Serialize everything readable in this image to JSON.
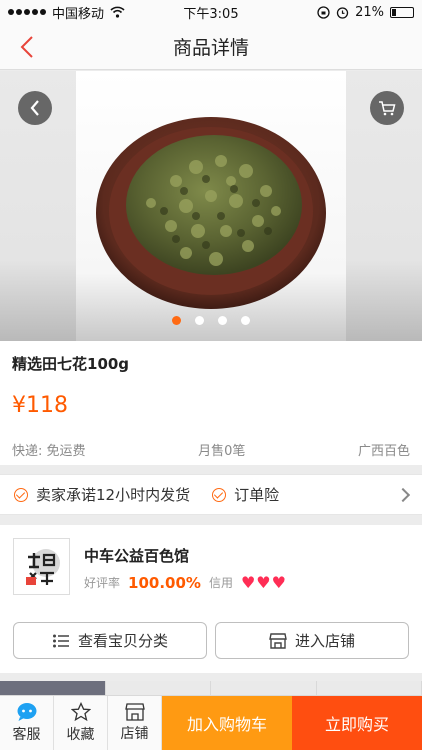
{
  "status": {
    "carrier": "中国移动",
    "time": "下午3:05",
    "battery": "21%"
  },
  "nav": {
    "title": "商品详情"
  },
  "gallery": {
    "pages": 4,
    "active_index": 0
  },
  "product": {
    "title": "精选田七花100g",
    "price": "¥118",
    "shipping": "快递: 免运费",
    "monthly_sales": "月售0笔",
    "location": "广西百色"
  },
  "promise": {
    "item1": "卖家承诺12小时内发货",
    "item2": "订单险"
  },
  "shop": {
    "name": "中车公益百色馆",
    "rating_label": "好评率",
    "rating_value": "100.00%",
    "credit_label": "信用",
    "browse_label": "查看宝贝分类",
    "enter_label": "进入店铺"
  },
  "tabbar": {
    "service": "客服",
    "favorite": "收藏",
    "store": "店铺",
    "add_cart": "加入购物车",
    "buy_now": "立即购买"
  },
  "colors": {
    "accent": "#ff6a13",
    "price": "#ff5a00",
    "cart": "#ff9a12",
    "buy": "#ff4e10"
  }
}
